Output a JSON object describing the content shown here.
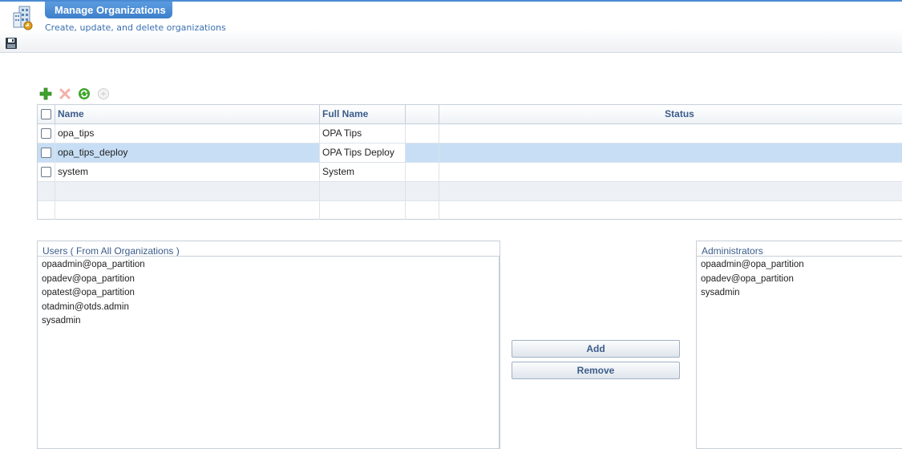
{
  "header": {
    "icon": "organization-building-icon",
    "title": "Manage Organizations",
    "subtitle": "Create, update, and delete organizations",
    "save_icon": "save-disk-icon"
  },
  "toolbar": {
    "icons": [
      "add-plus-icon",
      "delete-x-icon",
      "refresh-icon",
      "disabled-action-icon"
    ]
  },
  "grid": {
    "columns": [
      "Name",
      "Full Name",
      "",
      "Status"
    ],
    "rows": [
      {
        "name": "opa_tips",
        "full_name": "OPA Tips",
        "status": ""
      },
      {
        "name": "opa_tips_deploy",
        "full_name": "OPA Tips Deploy",
        "status": ""
      },
      {
        "name": "system",
        "full_name": "System",
        "status": ""
      }
    ],
    "selected_row": 1
  },
  "users_panel": {
    "title": "Users ( From All Organizations )",
    "items": [
      "opaadmin@opa_partition",
      "opadev@opa_partition",
      "opatest@opa_partition",
      "otadmin@otds.admin",
      "sysadmin"
    ]
  },
  "buttons": {
    "add": "Add",
    "remove": "Remove"
  },
  "admins_panel": {
    "title": "Administrators",
    "items": [
      "opaadmin@opa_partition",
      "opadev@opa_partition",
      "sysadmin"
    ]
  },
  "colors": {
    "accent": "#3d7fcb",
    "selected_row": "#c7def5",
    "label_blue": "#3b5c8a"
  }
}
